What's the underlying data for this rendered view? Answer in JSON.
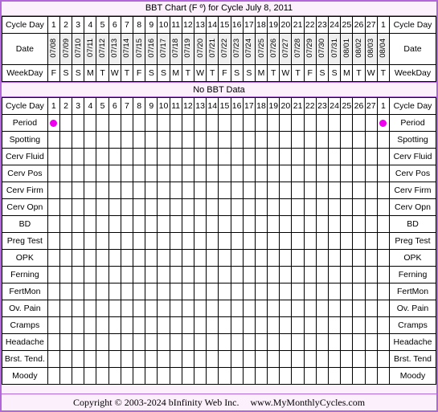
{
  "title": "BBT Chart (F º) for Cycle July 8, 2011",
  "colors": {
    "frame_border": "#b366d9",
    "panel_bg": "#fbf0fb",
    "header_cell_bg": "#efefef",
    "cell_bg": "#ffffff",
    "period_marker": "#ee00ee",
    "grid_line": "#000000"
  },
  "headers": {
    "cycle_day_label": "Cycle Day",
    "date_label": "Date",
    "weekday_label": "WeekDay"
  },
  "cycle_days": [
    "1",
    "2",
    "3",
    "4",
    "5",
    "6",
    "7",
    "8",
    "9",
    "10",
    "11",
    "12",
    "13",
    "14",
    "15",
    "16",
    "17",
    "18",
    "19",
    "20",
    "21",
    "22",
    "23",
    "24",
    "25",
    "26",
    "27",
    "1"
  ],
  "dates": [
    "07/08",
    "07/09",
    "07/10",
    "07/11",
    "07/12",
    "07/13",
    "07/14",
    "07/15",
    "07/16",
    "07/17",
    "07/18",
    "07/19",
    "07/20",
    "07/21",
    "07/22",
    "07/23",
    "07/24",
    "07/25",
    "07/26",
    "07/27",
    "07/28",
    "07/29",
    "07/30",
    "07/31",
    "08/01",
    "08/02",
    "08/03",
    "08/04"
  ],
  "weekdays": [
    "F",
    "S",
    "S",
    "M",
    "T",
    "W",
    "T",
    "F",
    "S",
    "S",
    "M",
    "T",
    "W",
    "T",
    "F",
    "S",
    "S",
    "M",
    "T",
    "W",
    "T",
    "F",
    "S",
    "S",
    "M",
    "T",
    "W",
    "T"
  ],
  "bbt_message": "No BBT Data",
  "rows": [
    {
      "label": "Period",
      "right_label": "Period",
      "tall": false,
      "marks": [
        1,
        0,
        0,
        0,
        0,
        0,
        0,
        0,
        0,
        0,
        0,
        0,
        0,
        0,
        0,
        0,
        0,
        0,
        0,
        0,
        0,
        0,
        0,
        0,
        0,
        0,
        0,
        1
      ]
    },
    {
      "label": "Spotting",
      "right_label": "Spotting",
      "tall": false,
      "marks": [
        0,
        0,
        0,
        0,
        0,
        0,
        0,
        0,
        0,
        0,
        0,
        0,
        0,
        0,
        0,
        0,
        0,
        0,
        0,
        0,
        0,
        0,
        0,
        0,
        0,
        0,
        0,
        0
      ]
    },
    {
      "label": "Cerv Fluid",
      "right_label": "Cerv Fluid",
      "tall": true,
      "marks": [
        0,
        0,
        0,
        0,
        0,
        0,
        0,
        0,
        0,
        0,
        0,
        0,
        0,
        0,
        0,
        0,
        0,
        0,
        0,
        0,
        0,
        0,
        0,
        0,
        0,
        0,
        0,
        0
      ]
    },
    {
      "label": "Cerv Pos",
      "right_label": "Cerv Pos",
      "tall": false,
      "marks": [
        0,
        0,
        0,
        0,
        0,
        0,
        0,
        0,
        0,
        0,
        0,
        0,
        0,
        0,
        0,
        0,
        0,
        0,
        0,
        0,
        0,
        0,
        0,
        0,
        0,
        0,
        0,
        0
      ]
    },
    {
      "label": "Cerv Firm",
      "right_label": "Cerv Firm",
      "tall": false,
      "marks": [
        0,
        0,
        0,
        0,
        0,
        0,
        0,
        0,
        0,
        0,
        0,
        0,
        0,
        0,
        0,
        0,
        0,
        0,
        0,
        0,
        0,
        0,
        0,
        0,
        0,
        0,
        0,
        0
      ]
    },
    {
      "label": "Cerv Opn",
      "right_label": "Cerv Opn",
      "tall": false,
      "marks": [
        0,
        0,
        0,
        0,
        0,
        0,
        0,
        0,
        0,
        0,
        0,
        0,
        0,
        0,
        0,
        0,
        0,
        0,
        0,
        0,
        0,
        0,
        0,
        0,
        0,
        0,
        0,
        0
      ]
    },
    {
      "label": "BD",
      "right_label": "BD",
      "tall": false,
      "marks": [
        0,
        0,
        0,
        0,
        0,
        0,
        0,
        0,
        0,
        0,
        0,
        0,
        0,
        0,
        0,
        0,
        0,
        0,
        0,
        0,
        0,
        0,
        0,
        0,
        0,
        0,
        0,
        0
      ]
    },
    {
      "label": "Preg Test",
      "right_label": "Preg Test",
      "tall": false,
      "marks": [
        0,
        0,
        0,
        0,
        0,
        0,
        0,
        0,
        0,
        0,
        0,
        0,
        0,
        0,
        0,
        0,
        0,
        0,
        0,
        0,
        0,
        0,
        0,
        0,
        0,
        0,
        0,
        0
      ]
    },
    {
      "label": "OPK",
      "right_label": "OPK",
      "tall": false,
      "marks": [
        0,
        0,
        0,
        0,
        0,
        0,
        0,
        0,
        0,
        0,
        0,
        0,
        0,
        0,
        0,
        0,
        0,
        0,
        0,
        0,
        0,
        0,
        0,
        0,
        0,
        0,
        0,
        0
      ]
    },
    {
      "label": "Ferning",
      "right_label": "Ferning",
      "tall": false,
      "marks": [
        0,
        0,
        0,
        0,
        0,
        0,
        0,
        0,
        0,
        0,
        0,
        0,
        0,
        0,
        0,
        0,
        0,
        0,
        0,
        0,
        0,
        0,
        0,
        0,
        0,
        0,
        0,
        0
      ]
    },
    {
      "label": "FertMon",
      "right_label": "FertMon",
      "tall": false,
      "marks": [
        0,
        0,
        0,
        0,
        0,
        0,
        0,
        0,
        0,
        0,
        0,
        0,
        0,
        0,
        0,
        0,
        0,
        0,
        0,
        0,
        0,
        0,
        0,
        0,
        0,
        0,
        0,
        0
      ]
    },
    {
      "label": "Ov. Pain",
      "right_label": "Ov. Pain",
      "tall": false,
      "marks": [
        0,
        0,
        0,
        0,
        0,
        0,
        0,
        0,
        0,
        0,
        0,
        0,
        0,
        0,
        0,
        0,
        0,
        0,
        0,
        0,
        0,
        0,
        0,
        0,
        0,
        0,
        0,
        0
      ]
    },
    {
      "label": "Cramps",
      "right_label": "Cramps",
      "tall": false,
      "marks": [
        0,
        0,
        0,
        0,
        0,
        0,
        0,
        0,
        0,
        0,
        0,
        0,
        0,
        0,
        0,
        0,
        0,
        0,
        0,
        0,
        0,
        0,
        0,
        0,
        0,
        0,
        0,
        0
      ]
    },
    {
      "label": "Headache",
      "right_label": "Headache",
      "tall": false,
      "marks": [
        0,
        0,
        0,
        0,
        0,
        0,
        0,
        0,
        0,
        0,
        0,
        0,
        0,
        0,
        0,
        0,
        0,
        0,
        0,
        0,
        0,
        0,
        0,
        0,
        0,
        0,
        0,
        0
      ]
    },
    {
      "label": "Brst. Tend.",
      "right_label": "Brst. Tend",
      "tall": false,
      "marks": [
        0,
        0,
        0,
        0,
        0,
        0,
        0,
        0,
        0,
        0,
        0,
        0,
        0,
        0,
        0,
        0,
        0,
        0,
        0,
        0,
        0,
        0,
        0,
        0,
        0,
        0,
        0,
        0
      ]
    },
    {
      "label": "Moody",
      "right_label": "Moody",
      "tall": false,
      "marks": [
        0,
        0,
        0,
        0,
        0,
        0,
        0,
        0,
        0,
        0,
        0,
        0,
        0,
        0,
        0,
        0,
        0,
        0,
        0,
        0,
        0,
        0,
        0,
        0,
        0,
        0,
        0,
        0
      ]
    }
  ],
  "footer": {
    "copyright": "Copyright © 2003-2024 bInfinity Web Inc.",
    "website": "www.MyMonthlyCycles.com"
  },
  "chart_data": {
    "type": "table",
    "title": "BBT Chart (F º) for Cycle July 8, 2011",
    "xlabel": "Cycle Day",
    "ylabel": "",
    "note": "No BBT Data",
    "categories": [
      "1",
      "2",
      "3",
      "4",
      "5",
      "6",
      "7",
      "8",
      "9",
      "10",
      "11",
      "12",
      "13",
      "14",
      "15",
      "16",
      "17",
      "18",
      "19",
      "20",
      "21",
      "22",
      "23",
      "24",
      "25",
      "26",
      "27",
      "1"
    ],
    "x_secondary": [
      "07/08",
      "07/09",
      "07/10",
      "07/11",
      "07/12",
      "07/13",
      "07/14",
      "07/15",
      "07/16",
      "07/17",
      "07/18",
      "07/19",
      "07/20",
      "07/21",
      "07/22",
      "07/23",
      "07/24",
      "07/25",
      "07/26",
      "07/27",
      "07/28",
      "07/29",
      "07/30",
      "07/31",
      "08/01",
      "08/02",
      "08/03",
      "08/04"
    ],
    "x_weekday": [
      "F",
      "S",
      "S",
      "M",
      "T",
      "W",
      "T",
      "F",
      "S",
      "S",
      "M",
      "T",
      "W",
      "T",
      "F",
      "S",
      "S",
      "M",
      "T",
      "W",
      "T",
      "F",
      "S",
      "S",
      "M",
      "T",
      "W",
      "T"
    ],
    "series": [
      {
        "name": "BBT (Fº)",
        "values": []
      },
      {
        "name": "Period",
        "values": [
          1,
          0,
          0,
          0,
          0,
          0,
          0,
          0,
          0,
          0,
          0,
          0,
          0,
          0,
          0,
          0,
          0,
          0,
          0,
          0,
          0,
          0,
          0,
          0,
          0,
          0,
          0,
          1
        ]
      },
      {
        "name": "Spotting",
        "values": [
          0,
          0,
          0,
          0,
          0,
          0,
          0,
          0,
          0,
          0,
          0,
          0,
          0,
          0,
          0,
          0,
          0,
          0,
          0,
          0,
          0,
          0,
          0,
          0,
          0,
          0,
          0,
          0
        ]
      },
      {
        "name": "Cerv Fluid",
        "values": [
          0,
          0,
          0,
          0,
          0,
          0,
          0,
          0,
          0,
          0,
          0,
          0,
          0,
          0,
          0,
          0,
          0,
          0,
          0,
          0,
          0,
          0,
          0,
          0,
          0,
          0,
          0,
          0
        ]
      },
      {
        "name": "Cerv Pos",
        "values": [
          0,
          0,
          0,
          0,
          0,
          0,
          0,
          0,
          0,
          0,
          0,
          0,
          0,
          0,
          0,
          0,
          0,
          0,
          0,
          0,
          0,
          0,
          0,
          0,
          0,
          0,
          0,
          0
        ]
      },
      {
        "name": "Cerv Firm",
        "values": [
          0,
          0,
          0,
          0,
          0,
          0,
          0,
          0,
          0,
          0,
          0,
          0,
          0,
          0,
          0,
          0,
          0,
          0,
          0,
          0,
          0,
          0,
          0,
          0,
          0,
          0,
          0,
          0
        ]
      },
      {
        "name": "Cerv Opn",
        "values": [
          0,
          0,
          0,
          0,
          0,
          0,
          0,
          0,
          0,
          0,
          0,
          0,
          0,
          0,
          0,
          0,
          0,
          0,
          0,
          0,
          0,
          0,
          0,
          0,
          0,
          0,
          0,
          0
        ]
      },
      {
        "name": "BD",
        "values": [
          0,
          0,
          0,
          0,
          0,
          0,
          0,
          0,
          0,
          0,
          0,
          0,
          0,
          0,
          0,
          0,
          0,
          0,
          0,
          0,
          0,
          0,
          0,
          0,
          0,
          0,
          0,
          0
        ]
      },
      {
        "name": "Preg Test",
        "values": [
          0,
          0,
          0,
          0,
          0,
          0,
          0,
          0,
          0,
          0,
          0,
          0,
          0,
          0,
          0,
          0,
          0,
          0,
          0,
          0,
          0,
          0,
          0,
          0,
          0,
          0,
          0,
          0
        ]
      },
      {
        "name": "OPK",
        "values": [
          0,
          0,
          0,
          0,
          0,
          0,
          0,
          0,
          0,
          0,
          0,
          0,
          0,
          0,
          0,
          0,
          0,
          0,
          0,
          0,
          0,
          0,
          0,
          0,
          0,
          0,
          0,
          0
        ]
      },
      {
        "name": "Ferning",
        "values": [
          0,
          0,
          0,
          0,
          0,
          0,
          0,
          0,
          0,
          0,
          0,
          0,
          0,
          0,
          0,
          0,
          0,
          0,
          0,
          0,
          0,
          0,
          0,
          0,
          0,
          0,
          0,
          0
        ]
      },
      {
        "name": "FertMon",
        "values": [
          0,
          0,
          0,
          0,
          0,
          0,
          0,
          0,
          0,
          0,
          0,
          0,
          0,
          0,
          0,
          0,
          0,
          0,
          0,
          0,
          0,
          0,
          0,
          0,
          0,
          0,
          0,
          0
        ]
      },
      {
        "name": "Ov. Pain",
        "values": [
          0,
          0,
          0,
          0,
          0,
          0,
          0,
          0,
          0,
          0,
          0,
          0,
          0,
          0,
          0,
          0,
          0,
          0,
          0,
          0,
          0,
          0,
          0,
          0,
          0,
          0,
          0,
          0
        ]
      },
      {
        "name": "Cramps",
        "values": [
          0,
          0,
          0,
          0,
          0,
          0,
          0,
          0,
          0,
          0,
          0,
          0,
          0,
          0,
          0,
          0,
          0,
          0,
          0,
          0,
          0,
          0,
          0,
          0,
          0,
          0,
          0,
          0
        ]
      },
      {
        "name": "Headache",
        "values": [
          0,
          0,
          0,
          0,
          0,
          0,
          0,
          0,
          0,
          0,
          0,
          0,
          0,
          0,
          0,
          0,
          0,
          0,
          0,
          0,
          0,
          0,
          0,
          0,
          0,
          0,
          0,
          0
        ]
      },
      {
        "name": "Brst. Tend.",
        "values": [
          0,
          0,
          0,
          0,
          0,
          0,
          0,
          0,
          0,
          0,
          0,
          0,
          0,
          0,
          0,
          0,
          0,
          0,
          0,
          0,
          0,
          0,
          0,
          0,
          0,
          0,
          0,
          0
        ]
      },
      {
        "name": "Moody",
        "values": [
          0,
          0,
          0,
          0,
          0,
          0,
          0,
          0,
          0,
          0,
          0,
          0,
          0,
          0,
          0,
          0,
          0,
          0,
          0,
          0,
          0,
          0,
          0,
          0,
          0,
          0,
          0,
          0
        ]
      }
    ],
    "grid": true,
    "legend": "none"
  }
}
